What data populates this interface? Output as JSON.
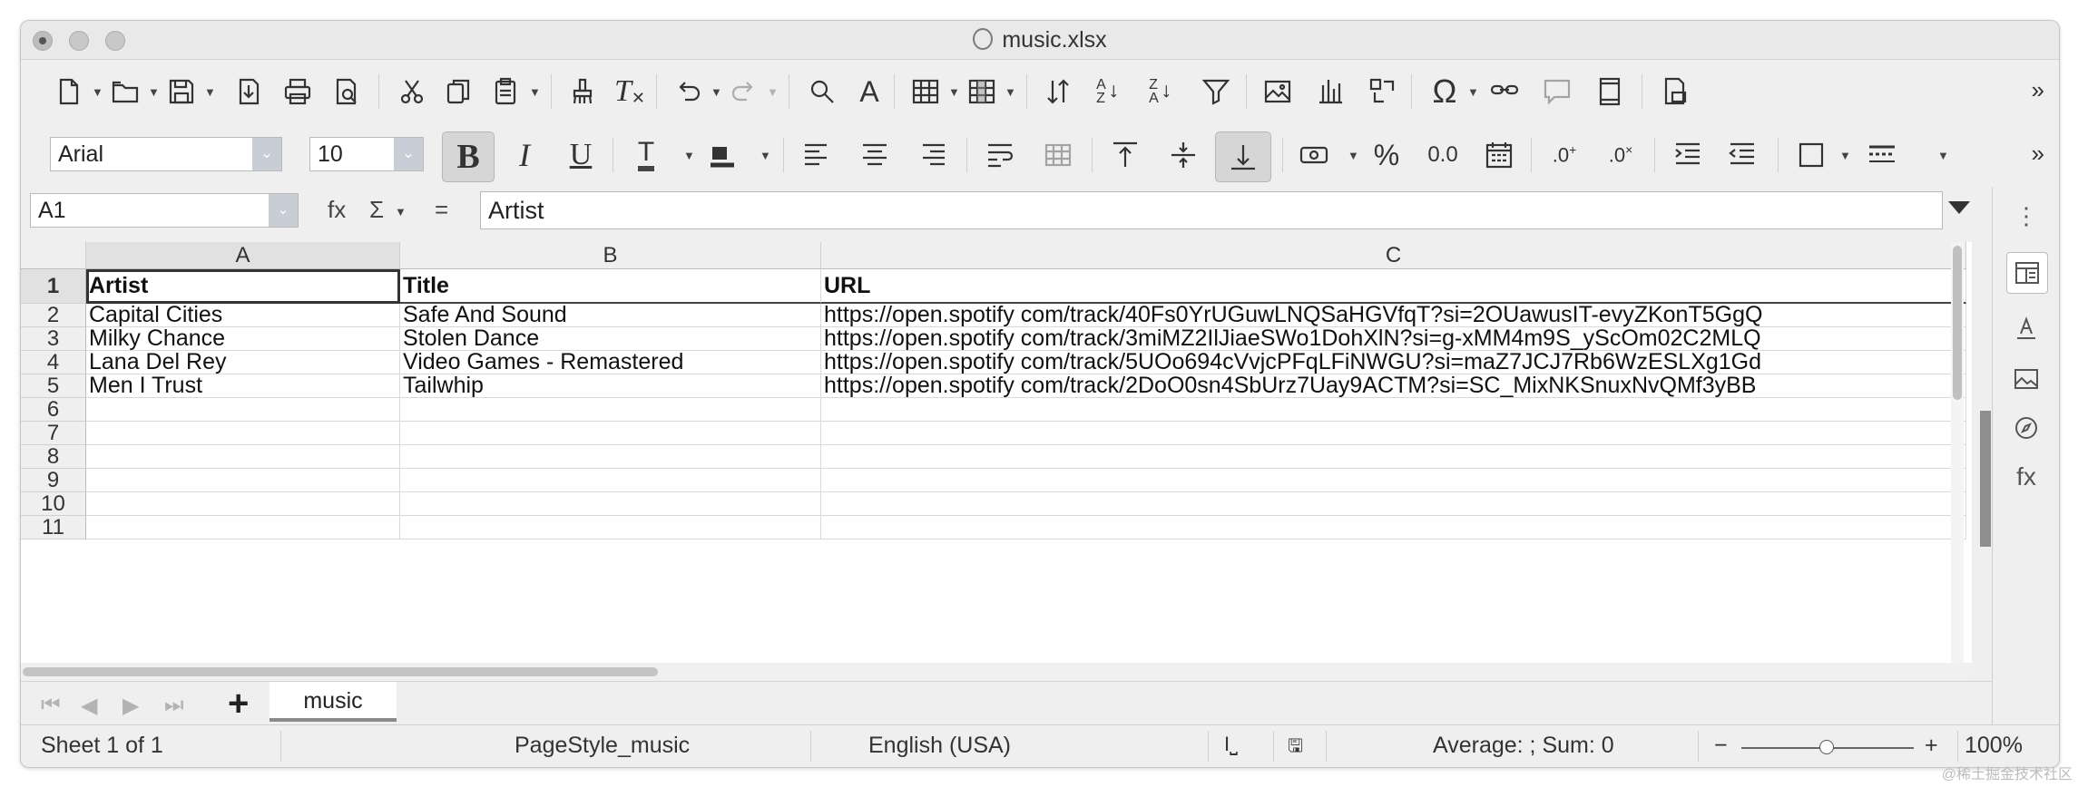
{
  "window": {
    "title": "music.xlsx"
  },
  "format_bar": {
    "font_name": "Arial",
    "font_size": "10"
  },
  "formula_bar": {
    "cell_ref": "A1",
    "content": "Artist",
    "func_icon": "fx",
    "sum_icon": "Σ",
    "equals": "="
  },
  "columns": [
    "A",
    "B",
    "C"
  ],
  "rows": [
    {
      "num": "1",
      "cells": [
        "Artist",
        "Title",
        "URL"
      ],
      "bold": true
    },
    {
      "num": "2",
      "cells": [
        "Capital Cities",
        "Safe And Sound",
        "https://open.spotify com/track/40Fs0YrUGuwLNQSaHGVfqT?si=2OUawusIT-evyZKonT5GgQ"
      ]
    },
    {
      "num": "3",
      "cells": [
        "Milky Chance",
        "Stolen Dance",
        "https://open.spotify com/track/3miMZ2IlJiaeSWo1DohXlN?si=g-xMM4m9S_yScOm02C2MLQ"
      ]
    },
    {
      "num": "4",
      "cells": [
        "Lana Del Rey",
        "Video Games - Remastered",
        "https://open.spotify com/track/5UOo694cVvjcPFqLFiNWGU?si=maZ7JCJ7Rb6WzESLXg1Gd"
      ]
    },
    {
      "num": "5",
      "cells": [
        "Men I Trust",
        "Tailwhip",
        "https://open.spotify com/track/2DoO0sn4SbUrz7Uay9ACTM?si=SC_MixNKSnuxNvQMf3yBB"
      ]
    },
    {
      "num": "6",
      "cells": [
        "",
        "",
        ""
      ]
    },
    {
      "num": "7",
      "cells": [
        "",
        "",
        ""
      ]
    },
    {
      "num": "8",
      "cells": [
        "",
        "",
        ""
      ]
    },
    {
      "num": "9",
      "cells": [
        "",
        "",
        ""
      ]
    },
    {
      "num": "10",
      "cells": [
        "",
        "",
        ""
      ]
    },
    {
      "num": "11",
      "cells": [
        "",
        "",
        ""
      ]
    }
  ],
  "sheet_tab": {
    "name": "music",
    "add_label": "+"
  },
  "status": {
    "sheet": "Sheet 1 of 1",
    "page_style": "PageStyle_music",
    "language": "English (USA)",
    "stats": "Average: ; Sum: 0",
    "zoom_minus": "−",
    "zoom_plus": "+",
    "zoom": "100%"
  },
  "overflow_label": "»",
  "watermark": "@稀土掘金技术社区"
}
